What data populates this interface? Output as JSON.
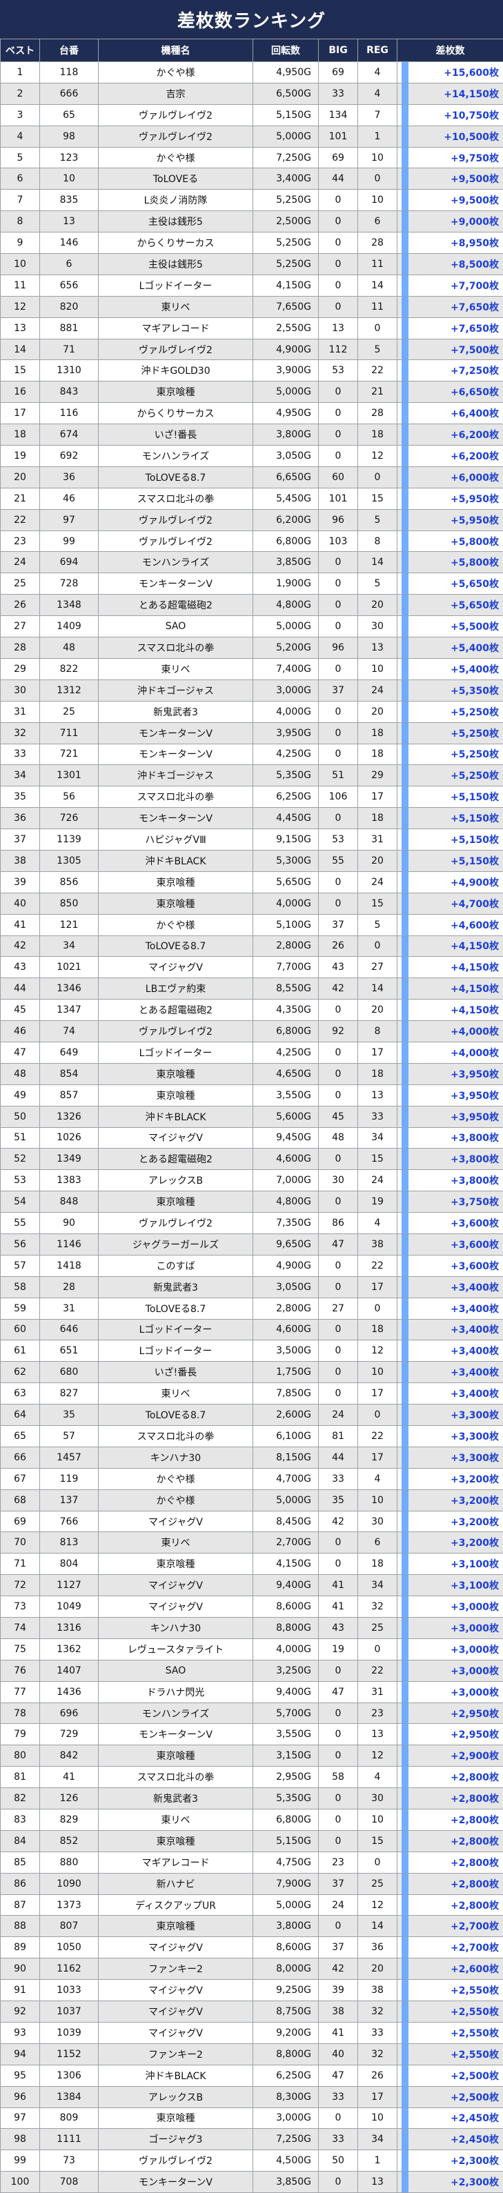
{
  "title": "差枚数ランキング",
  "headers": [
    "ベスト",
    "台番",
    "機種名",
    "回転数",
    "BIG",
    "REG",
    "差枚数"
  ],
  "colors": {
    "header_bg": "#1f2d55",
    "diff_text": "#1d3fd8",
    "bar": "#5aa0ff",
    "row_alt": "#e6e6e6"
  },
  "rows": [
    [
      "1",
      "118",
      "かぐや様",
      "4,950G",
      "69",
      "4",
      "+15,600枚"
    ],
    [
      "2",
      "666",
      "吉宗",
      "6,500G",
      "33",
      "4",
      "+14,150枚"
    ],
    [
      "3",
      "65",
      "ヴァルヴレイヴ2",
      "5,150G",
      "134",
      "7",
      "+10,750枚"
    ],
    [
      "4",
      "98",
      "ヴァルヴレイヴ2",
      "5,000G",
      "101",
      "1",
      "+10,500枚"
    ],
    [
      "5",
      "123",
      "かぐや様",
      "7,250G",
      "69",
      "10",
      "+9,750枚"
    ],
    [
      "6",
      "10",
      "ToLOVEる",
      "3,400G",
      "44",
      "0",
      "+9,500枚"
    ],
    [
      "7",
      "835",
      "L炎炎ノ消防隊",
      "5,250G",
      "0",
      "10",
      "+9,500枚"
    ],
    [
      "8",
      "13",
      "主役は銭形5",
      "2,500G",
      "0",
      "6",
      "+9,000枚"
    ],
    [
      "9",
      "146",
      "からくりサーカス",
      "5,250G",
      "0",
      "28",
      "+8,950枚"
    ],
    [
      "10",
      "6",
      "主役は銭形5",
      "5,250G",
      "0",
      "11",
      "+8,500枚"
    ],
    [
      "11",
      "656",
      "Lゴッドイーター",
      "4,150G",
      "0",
      "14",
      "+7,700枚"
    ],
    [
      "12",
      "820",
      "東リベ",
      "7,650G",
      "0",
      "11",
      "+7,650枚"
    ],
    [
      "13",
      "881",
      "マギアレコード",
      "2,550G",
      "13",
      "0",
      "+7,650枚"
    ],
    [
      "14",
      "71",
      "ヴァルヴレイヴ2",
      "4,900G",
      "112",
      "5",
      "+7,500枚"
    ],
    [
      "15",
      "1310",
      "沖ドキGOLD30",
      "3,900G",
      "53",
      "22",
      "+7,250枚"
    ],
    [
      "16",
      "843",
      "東京喰種",
      "5,000G",
      "0",
      "21",
      "+6,650枚"
    ],
    [
      "17",
      "116",
      "からくりサーカス",
      "4,950G",
      "0",
      "28",
      "+6,400枚"
    ],
    [
      "18",
      "674",
      "いざ!番長",
      "3,800G",
      "0",
      "18",
      "+6,200枚"
    ],
    [
      "19",
      "692",
      "モンハンライズ",
      "3,050G",
      "0",
      "12",
      "+6,200枚"
    ],
    [
      "20",
      "36",
      "ToLOVEる8.7",
      "6,650G",
      "60",
      "0",
      "+6,000枚"
    ],
    [
      "21",
      "46",
      "スマスロ北斗の拳",
      "5,450G",
      "101",
      "15",
      "+5,950枚"
    ],
    [
      "22",
      "97",
      "ヴァルヴレイヴ2",
      "6,200G",
      "96",
      "5",
      "+5,950枚"
    ],
    [
      "23",
      "99",
      "ヴァルヴレイヴ2",
      "6,800G",
      "103",
      "8",
      "+5,800枚"
    ],
    [
      "24",
      "694",
      "モンハンライズ",
      "3,850G",
      "0",
      "14",
      "+5,800枚"
    ],
    [
      "25",
      "728",
      "モンキーターンV",
      "1,900G",
      "0",
      "5",
      "+5,650枚"
    ],
    [
      "26",
      "1348",
      "とある超電磁砲2",
      "4,800G",
      "0",
      "20",
      "+5,650枚"
    ],
    [
      "27",
      "1409",
      "SAO",
      "5,000G",
      "0",
      "30",
      "+5,500枚"
    ],
    [
      "28",
      "48",
      "スマスロ北斗の拳",
      "5,200G",
      "96",
      "13",
      "+5,400枚"
    ],
    [
      "29",
      "822",
      "東リベ",
      "7,400G",
      "0",
      "10",
      "+5,400枚"
    ],
    [
      "30",
      "1312",
      "沖ドキゴージャス",
      "3,000G",
      "37",
      "24",
      "+5,350枚"
    ],
    [
      "31",
      "25",
      "新鬼武者3",
      "4,000G",
      "0",
      "20",
      "+5,250枚"
    ],
    [
      "32",
      "711",
      "モンキーターンV",
      "3,950G",
      "0",
      "18",
      "+5,250枚"
    ],
    [
      "33",
      "721",
      "モンキーターンV",
      "4,250G",
      "0",
      "18",
      "+5,250枚"
    ],
    [
      "34",
      "1301",
      "沖ドキゴージャス",
      "5,350G",
      "51",
      "29",
      "+5,250枚"
    ],
    [
      "35",
      "56",
      "スマスロ北斗の拳",
      "6,250G",
      "106",
      "17",
      "+5,150枚"
    ],
    [
      "36",
      "726",
      "モンキーターンV",
      "4,450G",
      "0",
      "18",
      "+5,150枚"
    ],
    [
      "37",
      "1139",
      "ハピジャグVⅢ",
      "9,150G",
      "53",
      "31",
      "+5,150枚"
    ],
    [
      "38",
      "1305",
      "沖ドキBLACK",
      "5,300G",
      "55",
      "20",
      "+5,150枚"
    ],
    [
      "39",
      "856",
      "東京喰種",
      "5,650G",
      "0",
      "24",
      "+4,900枚"
    ],
    [
      "40",
      "850",
      "東京喰種",
      "4,000G",
      "0",
      "15",
      "+4,700枚"
    ],
    [
      "41",
      "121",
      "かぐや様",
      "5,100G",
      "37",
      "5",
      "+4,600枚"
    ],
    [
      "42",
      "34",
      "ToLOVEる8.7",
      "2,800G",
      "26",
      "0",
      "+4,150枚"
    ],
    [
      "43",
      "1021",
      "マイジャグV",
      "7,700G",
      "43",
      "27",
      "+4,150枚"
    ],
    [
      "44",
      "1346",
      "LBエヴァ約束",
      "8,550G",
      "42",
      "14",
      "+4,150枚"
    ],
    [
      "45",
      "1347",
      "とある超電磁砲2",
      "4,350G",
      "0",
      "20",
      "+4,150枚"
    ],
    [
      "46",
      "74",
      "ヴァルヴレイヴ2",
      "6,800G",
      "92",
      "8",
      "+4,000枚"
    ],
    [
      "47",
      "649",
      "Lゴッドイーター",
      "4,250G",
      "0",
      "17",
      "+4,000枚"
    ],
    [
      "48",
      "854",
      "東京喰種",
      "4,650G",
      "0",
      "18",
      "+3,950枚"
    ],
    [
      "49",
      "857",
      "東京喰種",
      "3,550G",
      "0",
      "13",
      "+3,950枚"
    ],
    [
      "50",
      "1326",
      "沖ドキBLACK",
      "5,600G",
      "45",
      "33",
      "+3,950枚"
    ],
    [
      "51",
      "1026",
      "マイジャグV",
      "9,450G",
      "48",
      "34",
      "+3,800枚"
    ],
    [
      "52",
      "1349",
      "とある超電磁砲2",
      "4,600G",
      "0",
      "15",
      "+3,800枚"
    ],
    [
      "53",
      "1383",
      "アレックスB",
      "7,000G",
      "30",
      "24",
      "+3,800枚"
    ],
    [
      "54",
      "848",
      "東京喰種",
      "4,800G",
      "0",
      "19",
      "+3,750枚"
    ],
    [
      "55",
      "90",
      "ヴァルヴレイヴ2",
      "7,350G",
      "86",
      "4",
      "+3,600枚"
    ],
    [
      "56",
      "1146",
      "ジャグラーガールズ",
      "9,650G",
      "47",
      "38",
      "+3,600枚"
    ],
    [
      "57",
      "1418",
      "このすば",
      "4,900G",
      "0",
      "22",
      "+3,600枚"
    ],
    [
      "58",
      "28",
      "新鬼武者3",
      "3,050G",
      "0",
      "17",
      "+3,400枚"
    ],
    [
      "59",
      "31",
      "ToLOVEる8.7",
      "2,800G",
      "27",
      "0",
      "+3,400枚"
    ],
    [
      "60",
      "646",
      "Lゴッドイーター",
      "4,600G",
      "0",
      "18",
      "+3,400枚"
    ],
    [
      "61",
      "651",
      "Lゴッドイーター",
      "3,500G",
      "0",
      "12",
      "+3,400枚"
    ],
    [
      "62",
      "680",
      "いざ!番長",
      "1,750G",
      "0",
      "10",
      "+3,400枚"
    ],
    [
      "63",
      "827",
      "東リベ",
      "7,850G",
      "0",
      "17",
      "+3,400枚"
    ],
    [
      "64",
      "35",
      "ToLOVEる8.7",
      "2,600G",
      "24",
      "0",
      "+3,300枚"
    ],
    [
      "65",
      "57",
      "スマスロ北斗の拳",
      "6,100G",
      "81",
      "22",
      "+3,300枚"
    ],
    [
      "66",
      "1457",
      "キンハナ30",
      "8,150G",
      "44",
      "17",
      "+3,300枚"
    ],
    [
      "67",
      "119",
      "かぐや様",
      "4,700G",
      "33",
      "4",
      "+3,200枚"
    ],
    [
      "68",
      "137",
      "かぐや様",
      "5,000G",
      "35",
      "10",
      "+3,200枚"
    ],
    [
      "69",
      "766",
      "マイジャグV",
      "8,450G",
      "42",
      "30",
      "+3,200枚"
    ],
    [
      "70",
      "813",
      "東リベ",
      "2,700G",
      "0",
      "6",
      "+3,200枚"
    ],
    [
      "71",
      "804",
      "東京喰種",
      "4,150G",
      "0",
      "18",
      "+3,100枚"
    ],
    [
      "72",
      "1127",
      "マイジャグV",
      "9,400G",
      "41",
      "34",
      "+3,100枚"
    ],
    [
      "73",
      "1049",
      "マイジャグV",
      "8,600G",
      "41",
      "32",
      "+3,000枚"
    ],
    [
      "74",
      "1316",
      "キンハナ30",
      "8,800G",
      "43",
      "25",
      "+3,000枚"
    ],
    [
      "75",
      "1362",
      "レヴュースタァライト",
      "4,000G",
      "19",
      "0",
      "+3,000枚"
    ],
    [
      "76",
      "1407",
      "SAO",
      "3,250G",
      "0",
      "22",
      "+3,000枚"
    ],
    [
      "77",
      "1436",
      "ドラハナ閃光",
      "9,400G",
      "47",
      "31",
      "+3,000枚"
    ],
    [
      "78",
      "696",
      "モンハンライズ",
      "5,700G",
      "0",
      "23",
      "+2,950枚"
    ],
    [
      "79",
      "729",
      "モンキーターンV",
      "3,550G",
      "0",
      "13",
      "+2,950枚"
    ],
    [
      "80",
      "842",
      "東京喰種",
      "3,150G",
      "0",
      "12",
      "+2,900枚"
    ],
    [
      "81",
      "41",
      "スマスロ北斗の拳",
      "2,950G",
      "58",
      "4",
      "+2,800枚"
    ],
    [
      "82",
      "126",
      "新鬼武者3",
      "5,350G",
      "0",
      "30",
      "+2,800枚"
    ],
    [
      "83",
      "829",
      "東リベ",
      "6,800G",
      "0",
      "10",
      "+2,800枚"
    ],
    [
      "84",
      "852",
      "東京喰種",
      "5,150G",
      "0",
      "15",
      "+2,800枚"
    ],
    [
      "85",
      "880",
      "マギアレコード",
      "4,750G",
      "23",
      "0",
      "+2,800枚"
    ],
    [
      "86",
      "1090",
      "新ハナビ",
      "7,900G",
      "37",
      "25",
      "+2,800枚"
    ],
    [
      "87",
      "1373",
      "ディスクアップUR",
      "5,000G",
      "24",
      "12",
      "+2,800枚"
    ],
    [
      "88",
      "807",
      "東京喰種",
      "3,800G",
      "0",
      "14",
      "+2,700枚"
    ],
    [
      "89",
      "1050",
      "マイジャグV",
      "8,600G",
      "37",
      "36",
      "+2,700枚"
    ],
    [
      "90",
      "1162",
      "ファンキー2",
      "8,000G",
      "42",
      "20",
      "+2,600枚"
    ],
    [
      "91",
      "1033",
      "マイジャグV",
      "9,250G",
      "39",
      "38",
      "+2,550枚"
    ],
    [
      "92",
      "1037",
      "マイジャグV",
      "8,750G",
      "38",
      "32",
      "+2,550枚"
    ],
    [
      "93",
      "1039",
      "マイジャグV",
      "9,200G",
      "41",
      "33",
      "+2,550枚"
    ],
    [
      "94",
      "1152",
      "ファンキー2",
      "8,800G",
      "40",
      "32",
      "+2,550枚"
    ],
    [
      "95",
      "1306",
      "沖ドキBLACK",
      "6,250G",
      "47",
      "26",
      "+2,500枚"
    ],
    [
      "96",
      "1384",
      "アレックスB",
      "8,300G",
      "33",
      "17",
      "+2,500枚"
    ],
    [
      "97",
      "809",
      "東京喰種",
      "3,000G",
      "0",
      "10",
      "+2,450枚"
    ],
    [
      "98",
      "1111",
      "ゴージャグ3",
      "7,250G",
      "33",
      "34",
      "+2,450枚"
    ],
    [
      "99",
      "73",
      "ヴァルヴレイヴ2",
      "4,500G",
      "50",
      "1",
      "+2,300枚"
    ],
    [
      "100",
      "708",
      "モンキーターンV",
      "3,850G",
      "0",
      "13",
      "+2,300枚"
    ]
  ]
}
